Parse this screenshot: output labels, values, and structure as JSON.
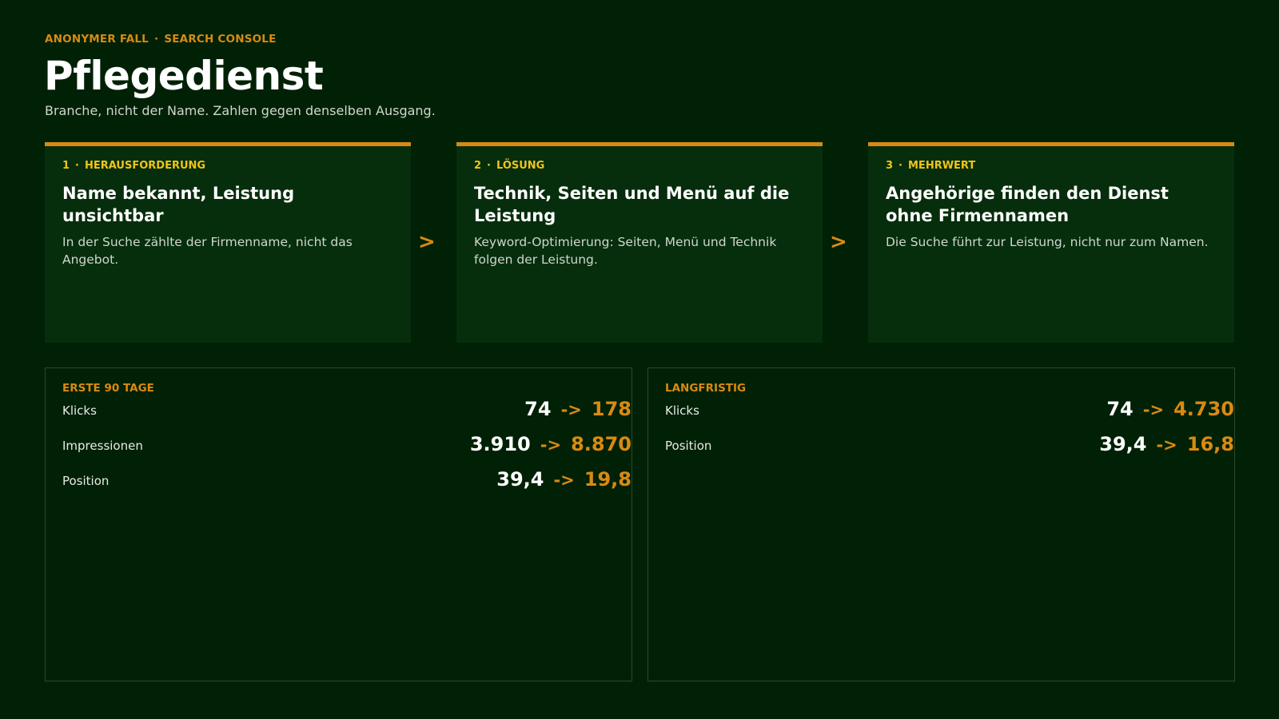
{
  "header": {
    "eyebrow_left": "ANONYMER FALL",
    "eyebrow_sep": "·",
    "eyebrow_right": "SEARCH CONSOLE",
    "title": "Pflegedienst",
    "subtitle": "Branche, nicht der Name. Zahlen gegen denselben Ausgang."
  },
  "steps": [
    {
      "num": "1",
      "label": "HERAUSFORDERUNG",
      "title": "Name bekannt, Leistung unsichtbar",
      "text": "In der Suche zählte der Firmenname, nicht das Angebot."
    },
    {
      "num": "2",
      "label": "LÖSUNG",
      "title": "Technik, Seiten und Menü auf die Leistung",
      "text": "Keyword-Optimierung: Seiten, Menü und Technik folgen der Leistung."
    },
    {
      "num": "3",
      "label": "MEHRWERT",
      "title": "Angehörige finden den Dienst ohne Firmennamen",
      "text": "Die Suche führt zur Leistung, nicht nur zum Namen."
    }
  ],
  "step_sep": "·",
  "step_arrow": ">",
  "panels": [
    {
      "label": "ERSTE 90 TAGE",
      "metrics": [
        {
          "name": "Klicks",
          "from": "74",
          "arrow": "->",
          "to": "178"
        },
        {
          "name": "Impressionen",
          "from": "3.910",
          "arrow": "->",
          "to": "8.870"
        },
        {
          "name": "Position",
          "from": "39,4",
          "arrow": "->",
          "to": "19,8"
        }
      ]
    },
    {
      "label": "LANGFRISTIG",
      "metrics": [
        {
          "name": "Klicks",
          "from": "74",
          "arrow": "->",
          "to": "4.730"
        },
        {
          "name": "Position",
          "from": "39,4",
          "arrow": "->",
          "to": "16,8"
        }
      ]
    }
  ],
  "colors": {
    "background": "#002105",
    "card": "#062e0c",
    "accent": "#d98a12",
    "label": "#f0c419"
  }
}
